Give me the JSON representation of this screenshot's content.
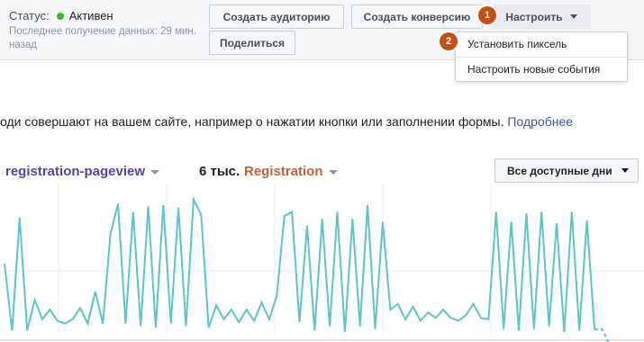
{
  "header": {
    "status_label": "Статус:",
    "status_value": "Активен",
    "status_color": "#42b72a",
    "last_data": "Последнее получение данных: 29 мин. назад",
    "buttons": {
      "create_audience": "Создать аудиторию",
      "create_conversion": "Создать конверсию",
      "setup": "Настроить",
      "share": "Поделиться"
    },
    "steps": [
      "1",
      "2"
    ],
    "setup_menu": [
      "Установить пиксель",
      "Настроить новые события"
    ]
  },
  "description": {
    "text": "оди совершают на вашем сайте, например о нажатии кнопки или заполнении формы.",
    "link": "Подробнее"
  },
  "metrics": {
    "primary": "registration-pageview",
    "value": "6 тыс.",
    "secondary": "Registration"
  },
  "range_select": {
    "value": "Все доступные дни"
  },
  "colors": {
    "line": "#5cc6c6",
    "primary_metric": "#5b3fa0",
    "secondary_metric": "#c0613b",
    "link": "#365899",
    "step_badge": "#c44f14"
  },
  "chart_data": {
    "type": "line",
    "series": [
      {
        "values": [
          0.53,
          0.05,
          0.86,
          0.05,
          0.27,
          0.13,
          0.2,
          0.12,
          0.1,
          0.13,
          0.21,
          0.1,
          0.33,
          0.1,
          0.74,
          0.96,
          0.1,
          0.9,
          0.08,
          0.94,
          0.07,
          0.95,
          0.1,
          0.93,
          0.08,
          0.99,
          0.88,
          0.07,
          0.23,
          0.13,
          0.2,
          0.11,
          0.2,
          0.12,
          0.25,
          0.13,
          0.3,
          0.87,
          0.9,
          0.11,
          0.8,
          0.05,
          0.85,
          0.08,
          0.9,
          0.04,
          0.85,
          0.08,
          0.95,
          0.06,
          0.83,
          0.2,
          0.24,
          0.13,
          0.22,
          0.12,
          0.18,
          0.14,
          0.2,
          0.14,
          0.12,
          0.16,
          0.24,
          0.14,
          0.13,
          0.9,
          0.06,
          0.83,
          0.05,
          0.89,
          0.06,
          0.9,
          0.08,
          0.82,
          0.04,
          0.9,
          0.05,
          0.84,
          0.06
        ],
        "trailing_dashed": [
          0.06,
          -0.05
        ]
      }
    ]
  }
}
